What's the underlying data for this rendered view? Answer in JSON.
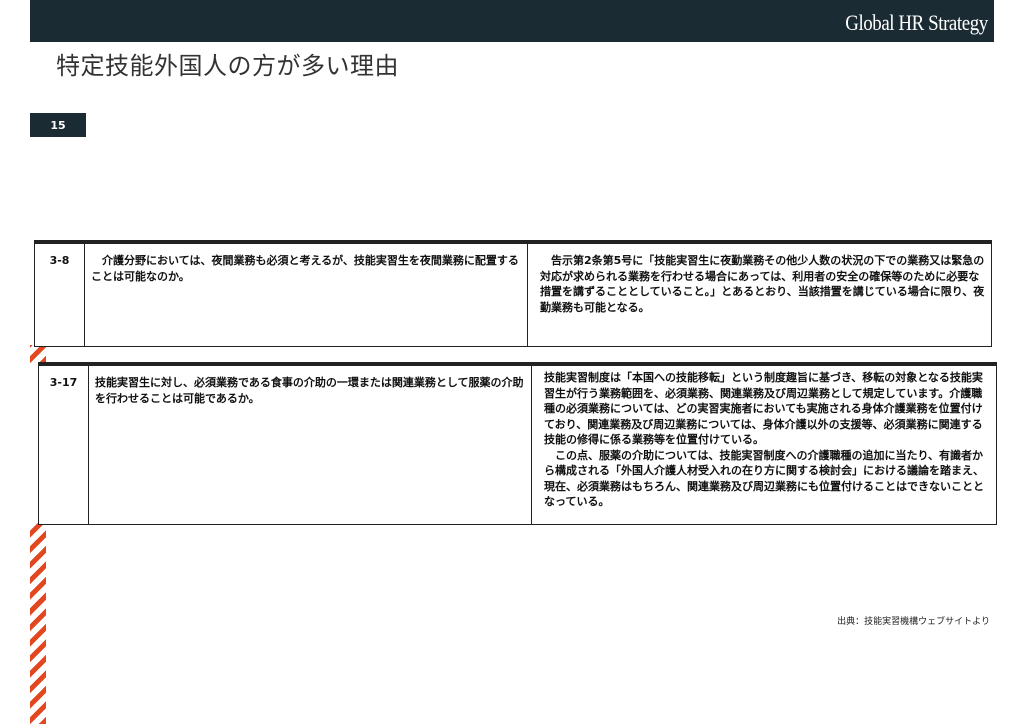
{
  "header": {
    "logo_text": "Global HR Strategy",
    "title": "特定技能外国人の方が多い理由",
    "page_number": "15"
  },
  "rows": [
    {
      "id": "3-8",
      "question": "介護分野においては、夜間業務も必須と考えるが、技能実習生を夜間業務に配置することは可能なのか。",
      "answer": "告示第2条第5号に「技能実習生に夜勤業務その他少人数の状況の下での業務又は緊急の対応が求められる業務を行わせる場合にあっては、利用者の安全の確保等のために必要な措置を講ずることとしていること。」とあるとおり、当該措置を講じている場合に限り、夜勤業務も可能となる。"
    },
    {
      "id": "3-17",
      "question": "技能実習生に対し、必須業務である食事の介助の一環または関連業務として服薬の介助を行わせることは可能であるか。",
      "answer_p1": "技能実習制度は「本国への技能移転」という制度趣旨に基づき、移転の対象となる技能実習生が行う業務範囲を、必須業務、関連業務及び周辺業務として規定しています。介護職種の必須業務については、どの実習実施者においても実施される身体介護業務を位置付けており、関連業務及び周辺業務については、身体介護以外の支援等、必須業務に関連する技能の修得に係る業務等を位置付けている。",
      "answer_p2": "この点、服薬の介助については、技能実習制度への介護職種の追加に当たり、有識者から構成される「外国人介護人材受入れの在り方に関する検討会」における議論を踏まえ、現在、必須業務はもちろん、関連業務及び周辺業務にも位置付けることはできないこととなっている。"
    }
  ],
  "source_note": "出典：技能実習機構ウェブサイトより",
  "colors": {
    "header_bg": "#1b2b34",
    "stripe": "#e2471f"
  }
}
